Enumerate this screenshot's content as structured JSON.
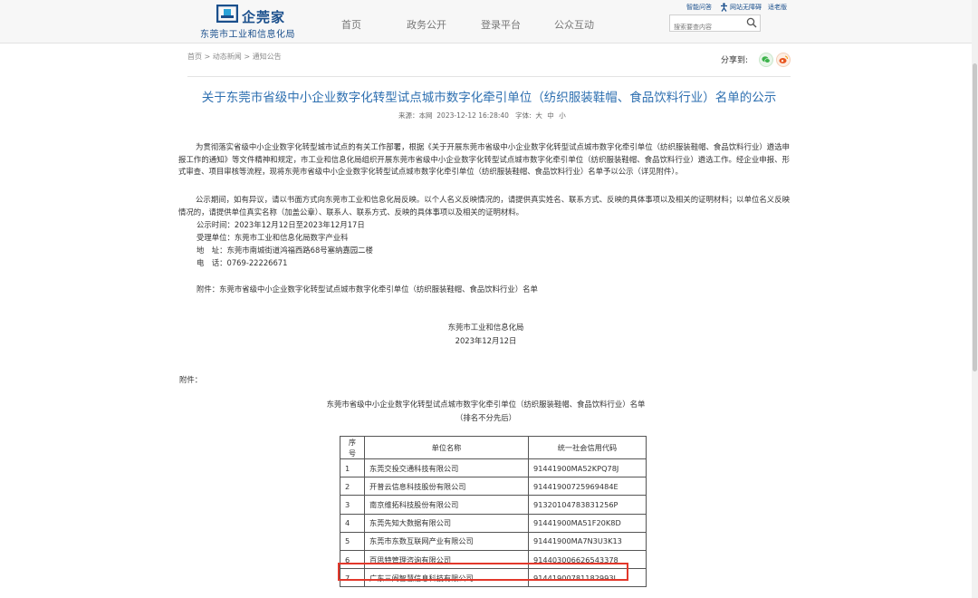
{
  "header": {
    "logo_brand": "企莞家",
    "logo_sub": "东莞市工业和信息化局",
    "nav": [
      "首页",
      "政务公开",
      "登录平台",
      "公众互动"
    ],
    "top_links": [
      "智能问答",
      "网站无障碍",
      "适老版"
    ],
    "search_placeholder": "搜索要查内容",
    "brand_color": "#1a4f8c"
  },
  "breadcrumb": {
    "items": [
      "首页",
      "动态新闻",
      "通知公告"
    ],
    "separator": ">"
  },
  "share": {
    "label": "分享到:",
    "icons": [
      "wechat-icon",
      "weibo-icon"
    ]
  },
  "article": {
    "title": "关于东莞市省级中小企业数字化转型试点城市数字化牵引单位（纺织服装鞋帽、食品饮料行业）名单的公示",
    "title_color": "#2d6fb0",
    "meta": {
      "source": "来源：本网",
      "date": "2023-12-12 16:28:40",
      "font_label": "字体:",
      "sizes": [
        "大",
        "中",
        "小"
      ]
    },
    "paragraphs": [
      "为贯彻落实省级中小企业数字化转型城市试点的有关工作部署，根据《关于开展东莞市省级中小企业数字化转型试点城市数字化牵引单位（纺织服装鞋帽、食品饮料行业）遴选申报工作的通知》等文件精神和规定，市工业和信息化局组织开展东莞市省级中小企业数字化转型试点城市数字化牵引单位（纺织服装鞋帽、食品饮料行业）遴选工作。经企业申报、形式审查、项目审核等流程，现将东莞市省级中小企业数字化转型试点城市数字化牵引单位（纺织服装鞋帽、食品饮料行业）名单予以公示（详见附件）。",
      "公示期间，如有异议，请以书面方式向东莞市工业和信息化局反映。以个人名义反映情况的，请提供真实姓名、联系方式、反映的具体事项以及相关的证明材料；以单位名义反映情况的，请提供单位真实名称（加盖公章）、联系人、联系方式、反映的具体事项以及相关的证明材料。"
    ],
    "lines": [
      "公示时间：2023年12月12日至2023年12月17日",
      "受理单位：东莞市工业和信息化局数字产业科",
      "地　址：东莞市南城街道鸿福西路68号塞纳嘉园二楼",
      "电　话：0769-22226671"
    ],
    "attachment_line": "附件：东莞市省级中小企业数字化转型试点城市数字化牵引单位（纺织服装鞋帽、食品饮料行业）名单",
    "signature": "东莞市工业和信息化局",
    "signature_date": "2023年12月12日"
  },
  "attachment": {
    "label": "附件：",
    "caption": "东莞市省级中小企业数字化转型试点城市数字化牵引单位（纺织服装鞋帽、食品饮料行业）名单",
    "sub_caption": "（排名不分先后）",
    "columns": [
      "序号",
      "单位名称",
      "统一社会信用代码"
    ],
    "rows": [
      [
        "1",
        "东莞交投交通科技有限公司",
        "91441900MA52KPQ78J"
      ],
      [
        "2",
        "开普云信息科技股份有限公司",
        "91441900725969484E"
      ],
      [
        "3",
        "南京维拓科技股份有限公司",
        "91320104783831256P"
      ],
      [
        "4",
        "东莞先知大数据有限公司",
        "91441900MA51F20K8D"
      ],
      [
        "5",
        "东莞市东数互联网产业有限公司",
        "91441900MA7N3U3K13"
      ],
      [
        "6",
        "百思特管理咨询有限公司",
        "914403006626543378"
      ],
      [
        "7",
        "广东三阖智慧信息科技有限公司",
        "91441900781182993L"
      ]
    ],
    "highlighted_row": 7,
    "highlight_color": "#e3382b"
  }
}
